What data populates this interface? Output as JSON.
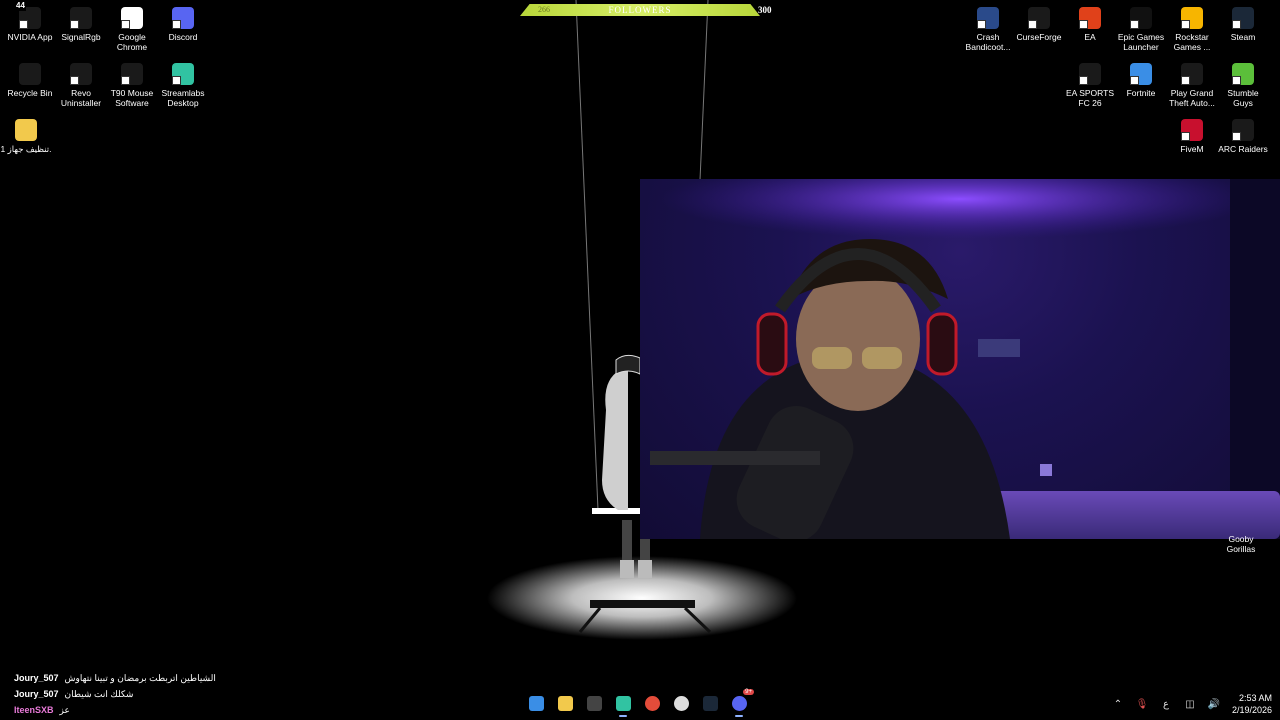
{
  "follower_goal": {
    "current": "266",
    "label": "FOLLOWERS",
    "goal": "300",
    "progress": 0.887
  },
  "desktop_left": [
    {
      "label": "NVIDIA App",
      "icon": "nvidia-icon",
      "badge": "44",
      "color": "#1a1a1a"
    },
    {
      "label": "SignalRgb",
      "icon": "signalrgb-icon",
      "color": "#1a1a1a"
    },
    {
      "label": "Google Chrome",
      "icon": "chrome-icon",
      "color": "#ffffff"
    },
    {
      "label": "Discord",
      "icon": "discord-icon",
      "color": "#5865f2"
    },
    {
      "label": "Recycle Bin",
      "icon": "recycle-bin-icon",
      "color": "#1a1a1a"
    },
    {
      "label": "Revo Uninstaller",
      "icon": "revo-icon",
      "color": "#1a1a1a"
    },
    {
      "label": "T90 Mouse Software",
      "icon": "mouse-icon",
      "color": "#1a1a1a"
    },
    {
      "label": "Streamlabs Desktop",
      "icon": "streamlabs-icon",
      "color": "#31c3a2"
    },
    {
      "label": "تنظيف جهاز 1.",
      "icon": "folder-icon",
      "color": "#f2c94c"
    }
  ],
  "desktop_right": [
    {
      "label": "Crash Bandicoot...",
      "icon": "crash-icon",
      "color": "#2a4a8a"
    },
    {
      "label": "CurseForge",
      "icon": "curseforge-icon",
      "color": "#1a1a1a"
    },
    {
      "label": "EA",
      "icon": "ea-icon",
      "color": "#e0411a"
    },
    {
      "label": "Epic Games Launcher",
      "icon": "epic-icon",
      "color": "#111111"
    },
    {
      "label": "Rockstar Games ...",
      "icon": "rockstar-icon",
      "color": "#f7b500"
    },
    {
      "label": "Steam",
      "icon": "steam-icon",
      "color": "#1b2838"
    },
    {
      "label": "EA SPORTS FC 26",
      "icon": "eafc-icon",
      "color": "#1a1a1a"
    },
    {
      "label": "Fortnite",
      "icon": "fortnite-icon",
      "color": "#3a8ee6"
    },
    {
      "label": "Play Grand Theft Auto...",
      "icon": "gta-icon",
      "color": "#1a1a1a"
    },
    {
      "label": "Stumble Guys",
      "icon": "stumble-icon",
      "color": "#5bbf3a"
    },
    {
      "label": "FiveM",
      "icon": "fivem-icon",
      "color": "#c8102e"
    },
    {
      "label": "ARC Raiders",
      "icon": "arc-icon",
      "color": "#1a1a1a"
    }
  ],
  "partial_icon_label": "Gooby Gorillas",
  "chat": [
    {
      "user": "Joury_507",
      "message": "الشياطين اتربطت برمضان و تبينا نتهاوش",
      "user_color": "#ffffff"
    },
    {
      "user": "Joury_507",
      "message": "شكلك انت شيطان",
      "user_color": "#ffffff"
    },
    {
      "user": "IteenSXB",
      "message": "عز",
      "user_color": "#e87ad8"
    }
  ],
  "taskbar": [
    {
      "icon": "windows-start-icon"
    },
    {
      "icon": "file-explorer-icon"
    },
    {
      "icon": "microsoft-store-icon"
    },
    {
      "icon": "streamlabs-taskbar-icon"
    },
    {
      "icon": "chrome-taskbar-icon"
    },
    {
      "icon": "obs-taskbar-icon"
    },
    {
      "icon": "steam-taskbar-icon"
    },
    {
      "icon": "discord-taskbar-icon",
      "badge": "9+"
    }
  ],
  "tray": {
    "language": "ع",
    "time": "2:53 AM",
    "date": "2/19/2026"
  }
}
